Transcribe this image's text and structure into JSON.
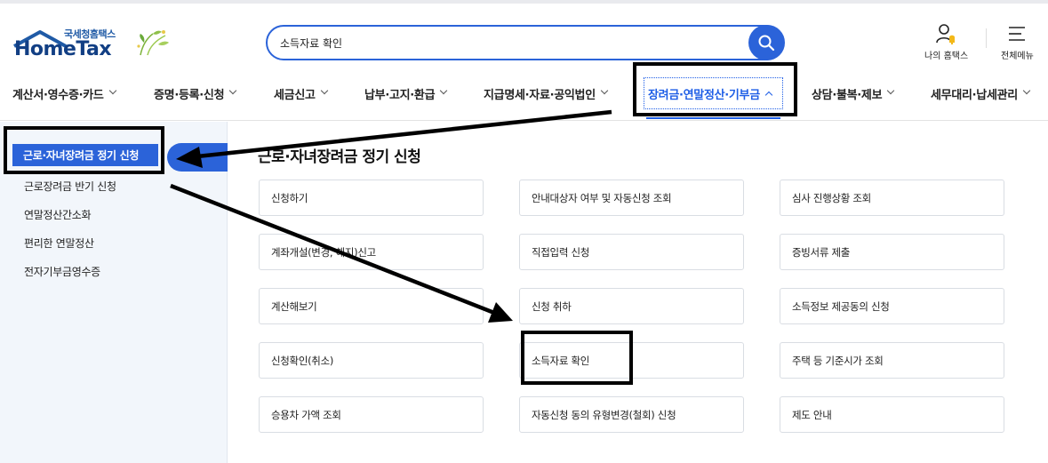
{
  "header": {
    "logo_sub": "국세청홈택스",
    "logo_main": "HomeTax",
    "search_value": "소득자료 확인",
    "my_hometax": "나의 홈택스",
    "all_menu": "전체메뉴"
  },
  "gnb": {
    "items": [
      {
        "label": "계산서·영수증·카드"
      },
      {
        "label": "증명·등록·신청"
      },
      {
        "label": "세금신고"
      },
      {
        "label": "납부·고지·환급"
      },
      {
        "label": "지급명세·자료·공익법인"
      },
      {
        "label": "장려금·연말정산·기부금"
      },
      {
        "label": "상담·불복·제보"
      },
      {
        "label": "세무대리·납세관리"
      }
    ],
    "active_index": 5
  },
  "sidebar": {
    "items": [
      {
        "label": "근로·자녀장려금 정기 신청"
      },
      {
        "label": "근로장려금 반기 신청"
      },
      {
        "label": "연말정산간소화"
      },
      {
        "label": "편리한 연말정산"
      },
      {
        "label": "전자기부금영수증"
      }
    ],
    "active_index": 0
  },
  "main": {
    "title": "근로·자녀장려금 정기 신청",
    "buttons": [
      {
        "label": "신청하기"
      },
      {
        "label": "안내대상자 여부 및 자동신청 조회"
      },
      {
        "label": "심사 진행상황 조회"
      },
      {
        "label": "계좌개설(변경, 해지)신고"
      },
      {
        "label": "직접입력 신청"
      },
      {
        "label": "증빙서류 제출"
      },
      {
        "label": "계산해보기"
      },
      {
        "label": "신청 취하"
      },
      {
        "label": "소득정보 제공동의 신청"
      },
      {
        "label": "신청확인(취소)"
      },
      {
        "label": "소득자료 확인"
      },
      {
        "label": "주택 등 기준시가 조회"
      },
      {
        "label": "승용차 가액 조회"
      },
      {
        "label": "자동신청 동의 유형변경(철회) 신청"
      },
      {
        "label": "제도 안내"
      }
    ]
  },
  "colors": {
    "accent": "#2b63d9",
    "active_text": "#1e5ee6",
    "logo_navy": "#123f84",
    "sidebar_bg": "#f2f6fb",
    "annotation": "#000000"
  }
}
